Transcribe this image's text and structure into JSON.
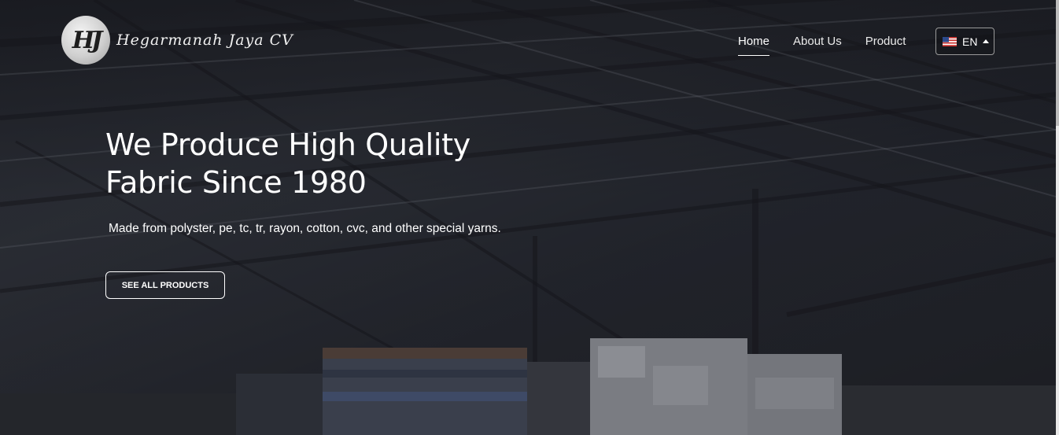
{
  "header": {
    "logo": {
      "monogram": "HJ",
      "name": "Hegarmanah Jaya CV"
    },
    "nav": [
      {
        "label": "Home",
        "active": true
      },
      {
        "label": "About Us",
        "active": false
      },
      {
        "label": "Product",
        "active": false
      }
    ],
    "language": {
      "code": "EN",
      "flag_icon": "us-flag-icon"
    }
  },
  "hero": {
    "title": "We Produce High Quality Fabric Since 1980",
    "subtitle": "Made from polyster, pe, tc, tr, rayon, cotton, cvc, and other special yarns.",
    "cta_label": "SEE ALL PRODUCTS"
  },
  "colors": {
    "overlay": "#15161b",
    "text": "#ffffff",
    "nav_text": "#eaeaea"
  }
}
